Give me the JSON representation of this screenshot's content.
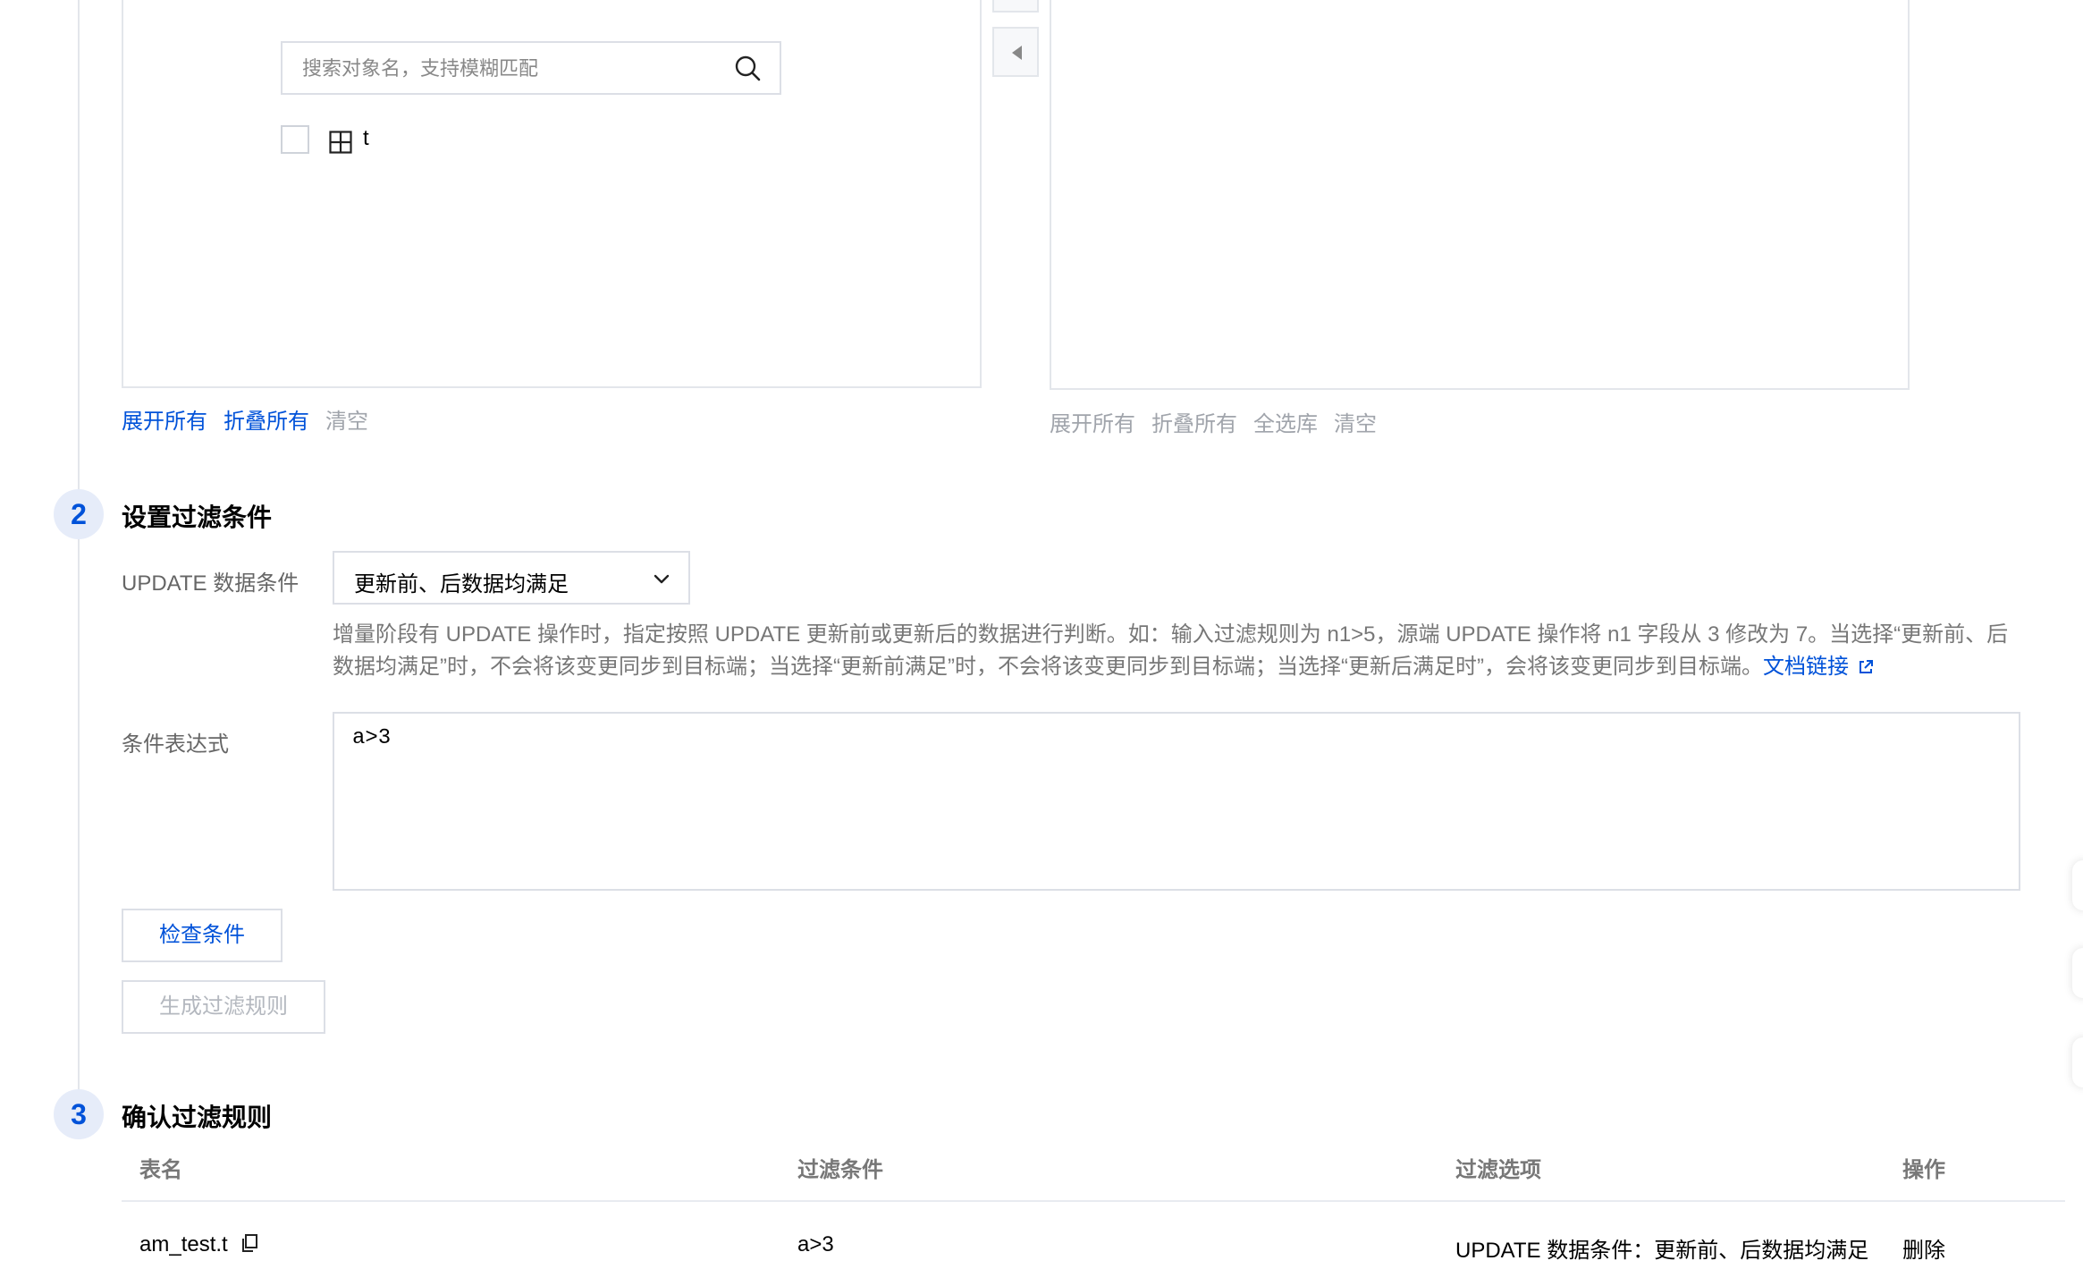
{
  "source_panel": {
    "search": {
      "placeholder": "搜索对象名，支持模糊匹配"
    },
    "table_item": {
      "label": "t"
    },
    "actions": {
      "expand_all": "展开所有",
      "collapse_all": "折叠所有",
      "clear": "清空"
    }
  },
  "target_panel": {
    "actions": {
      "expand_all": "展开所有",
      "collapse_all": "折叠所有",
      "select_all_db": "全选库",
      "clear": "清空"
    }
  },
  "step2": {
    "number": "2",
    "title": "设置过滤条件",
    "update_label": "UPDATE 数据条件",
    "update_value": "更新前、后数据均满足",
    "help_text": "增量阶段有 UPDATE 操作时，指定按照 UPDATE 更新前或更新后的数据进行判断。如：输入过滤规则为 n1>5，源端 UPDATE 操作将 n1 字段从 3 修改为 7。当选择“更新前、后数据均满足”时，不会将该变更同步到目标端；当选择“更新前满足”时，不会将该变更同步到目标端；当选择“更新后满足时”，会将该变更同步到目标端。",
    "doc_link": "文档链接",
    "expr_label": "条件表达式",
    "expr_value": "a>3",
    "check_button": "检查条件",
    "generate_button": "生成过滤规则"
  },
  "step3": {
    "number": "3",
    "title": "确认过滤规则",
    "columns": [
      "表名",
      "过滤条件",
      "过滤选项",
      "操作"
    ],
    "rows": [
      {
        "table": "am_test.t",
        "condition": "a>3",
        "option": "UPDATE 数据条件：更新前、后数据均满足",
        "action": "删除"
      }
    ]
  },
  "colors": {
    "accent": "#0052d9",
    "border": "#dcdfe6",
    "muted": "#a0a4ab"
  }
}
